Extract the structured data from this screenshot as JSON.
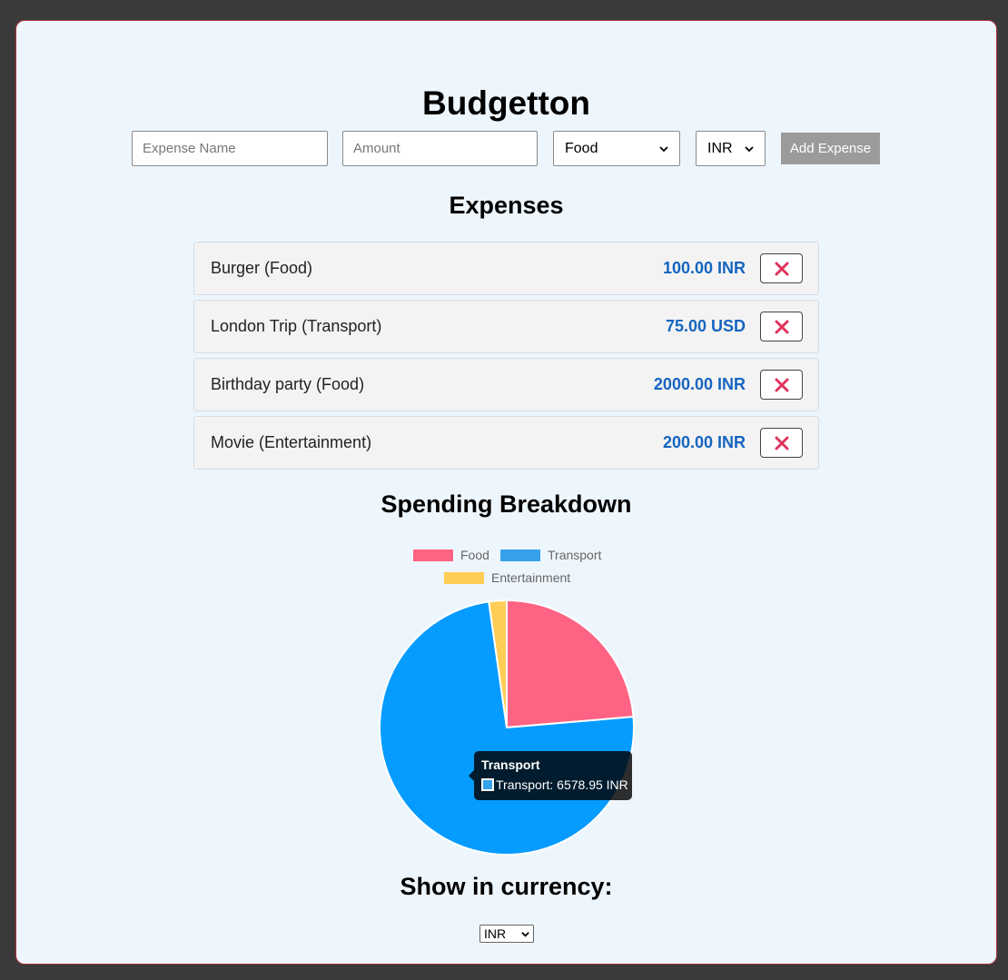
{
  "app": {
    "title": "Budgetton"
  },
  "form": {
    "name_placeholder": "Expense Name",
    "amount_placeholder": "Amount",
    "category_selected": "Food",
    "currency_selected": "INR",
    "add_label": "Add Expense"
  },
  "expenses": {
    "heading": "Expenses",
    "items": [
      {
        "name": "Burger (Food)",
        "amount": "100.00 INR"
      },
      {
        "name": "London Trip (Transport)",
        "amount": "75.00 USD"
      },
      {
        "name": "Birthday party (Food)",
        "amount": "2000.00 INR"
      },
      {
        "name": "Movie (Entertainment)",
        "amount": "200.00 INR"
      }
    ]
  },
  "breakdown": {
    "heading": "Spending Breakdown",
    "legend": [
      {
        "label": "Food",
        "color": "#ff6384"
      },
      {
        "label": "Transport",
        "color": "#36a2eb"
      },
      {
        "label": "Entertainment",
        "color": "#ffcd56"
      }
    ],
    "tooltip": {
      "title": "Transport",
      "body": "Transport: 6578.95 INR"
    }
  },
  "chart_data": {
    "type": "pie",
    "title": "",
    "categories": [
      "Food",
      "Transport",
      "Entertainment"
    ],
    "values": [
      2100,
      6578.95,
      200
    ],
    "colors": [
      "#ff6384",
      "#36a2eb",
      "#ffcd56"
    ],
    "legend_position": "top"
  },
  "display_currency": {
    "heading": "Show in currency:",
    "selected": "INR"
  },
  "colors": {
    "amount": "#1565c0",
    "delete_icon": "#e0335e",
    "add_button": "#9b9b9b"
  },
  "icons": {
    "delete": "close-icon",
    "dropdown": "chevron-down-icon"
  }
}
